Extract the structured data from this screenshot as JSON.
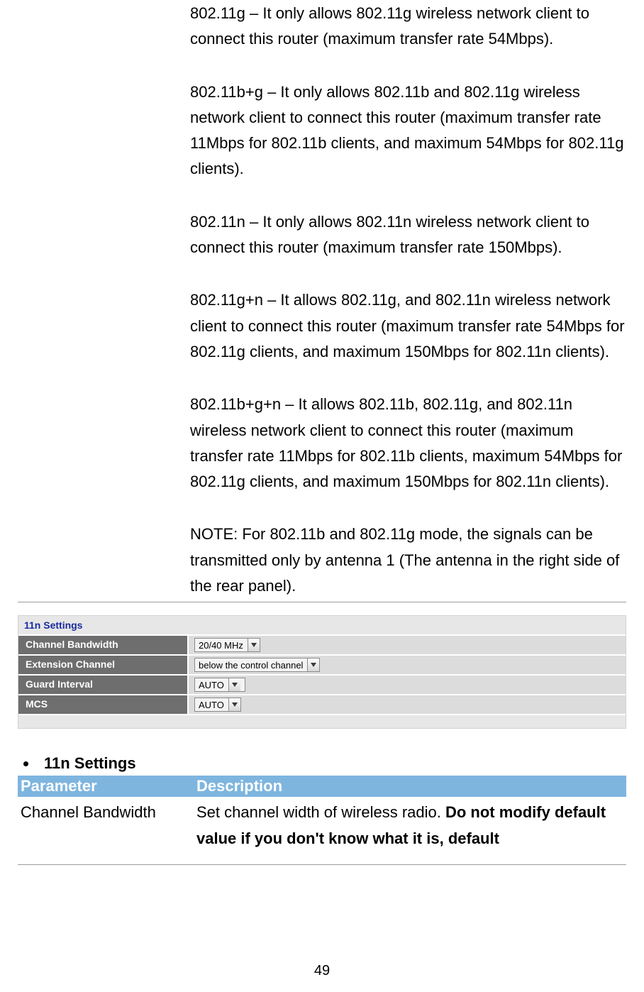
{
  "defs": {
    "p1": "802.11g – It only allows 802.11g wireless network client to connect this router (maximum transfer rate 54Mbps).",
    "p2": "802.11b+g – It only allows 802.11b and 802.11g wireless network client to connect this router (maximum transfer rate 11Mbps for 802.11b clients, and maximum 54Mbps for 802.11g clients).",
    "p3": "802.11n – It only allows 802.11n wireless network client to connect this router (maximum transfer rate 150Mbps).",
    "p4": "802.11g+n – It allows 802.11g, and 802.11n wireless network client to connect this router (maximum transfer rate 54Mbps for 802.11g clients, and maximum 150Mbps for 802.11n clients).",
    "p5": "802.11b+g+n – It allows 802.11b, 802.11g, and 802.11n wireless network client to connect this router (maximum transfer rate 11Mbps for 802.11b clients, maximum 54Mbps for 802.11g clients, and maximum 150Mbps for 802.11n clients).",
    "p6": "NOTE: For 802.11b and 802.11g mode, the signals can be transmitted only by antenna 1 (The antenna in the right side of the rear panel)."
  },
  "settings_panel": {
    "title": "11n Settings",
    "rows": [
      {
        "label": "Channel Bandwidth",
        "value": "20/40 MHz"
      },
      {
        "label": "Extension Channel",
        "value": "below the control channel"
      },
      {
        "label": "Guard Interval",
        "value": "AUTO"
      },
      {
        "label": "MCS",
        "value": "AUTO"
      }
    ]
  },
  "bullet_heading": "11n Settings",
  "param_table": {
    "headers": [
      "Parameter",
      "Description"
    ],
    "row0": {
      "name": "Channel Bandwidth",
      "desc_pre": "Set channel width of wireless radio. ",
      "desc_bold": "Do not modify default value if you don't know what it is, default"
    }
  },
  "page_number": "49"
}
